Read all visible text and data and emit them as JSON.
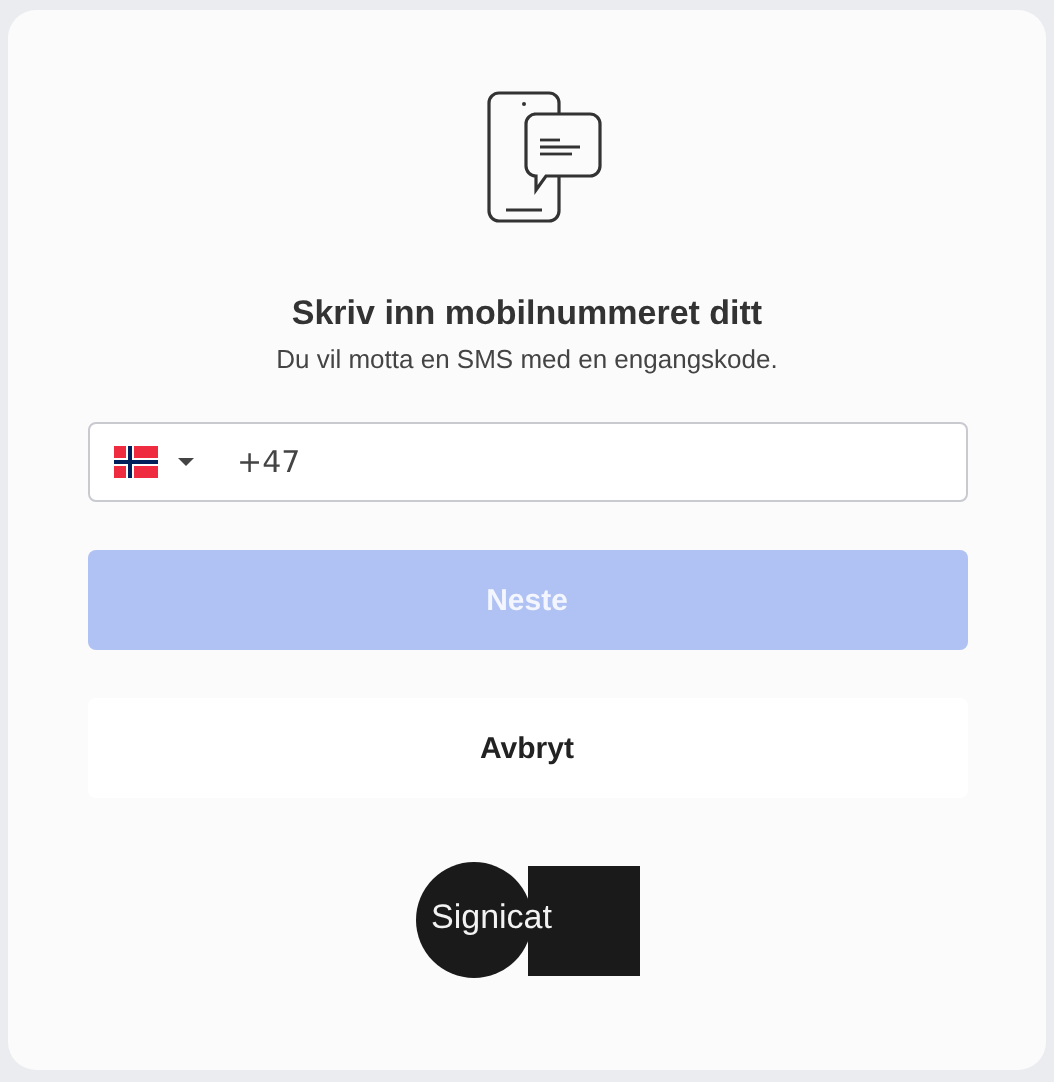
{
  "heading": "Skriv inn mobilnummeret ditt",
  "subheading": "Du vil motta en SMS med en engangskode.",
  "phone_field": {
    "value": "+47"
  },
  "buttons": [
    {
      "label": "Neste",
      "kind": "primary",
      "disabled": true
    },
    {
      "label": "Avbryt",
      "kind": "secondary",
      "disabled": false
    }
  ],
  "logo": {
    "text": "Signicat"
  }
}
